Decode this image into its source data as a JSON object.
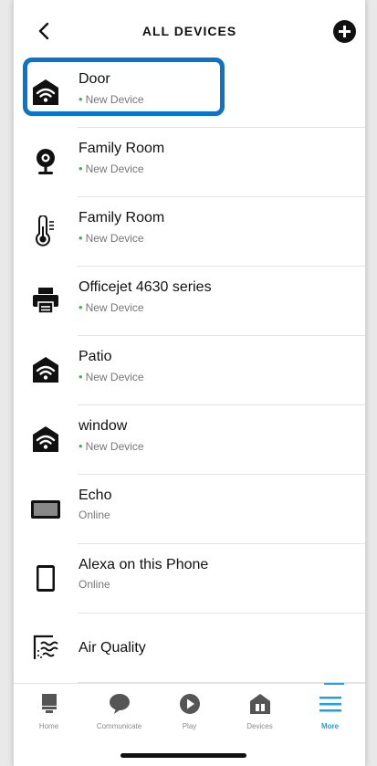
{
  "header": {
    "title": "ALL DEVICES"
  },
  "devices": [
    {
      "name": "Door",
      "status": "New Device",
      "icon": "wifi-home-icon"
    },
    {
      "name": "Family Room",
      "status": "New Device",
      "icon": "camera-icon"
    },
    {
      "name": "Family Room",
      "status": "New Device",
      "icon": "thermometer-icon"
    },
    {
      "name": "Officejet 4630 series",
      "status": "New Device",
      "icon": "printer-icon"
    },
    {
      "name": "Patio",
      "status": "New Device",
      "icon": "wifi-home-icon"
    },
    {
      "name": "window",
      "status": "New Device",
      "icon": "wifi-home-icon"
    },
    {
      "name": "Echo",
      "status": "Online",
      "icon": "echo-show-icon"
    },
    {
      "name": "Alexa on this Phone",
      "status": "Online",
      "icon": "phone-icon"
    },
    {
      "name": "Air Quality",
      "icon": "air-quality-icon"
    }
  ],
  "tabs": [
    {
      "label": "Home",
      "icon": "home-icon"
    },
    {
      "label": "Communicate",
      "icon": "chat-icon"
    },
    {
      "label": "Play",
      "icon": "play-icon"
    },
    {
      "label": "Devices",
      "icon": "devices-icon"
    },
    {
      "label": "More",
      "icon": "menu-icon",
      "active": true
    }
  ],
  "colors": {
    "accent": "#1da1e2",
    "highlight": "#0b74c7",
    "new_dot": "#39b54a"
  }
}
